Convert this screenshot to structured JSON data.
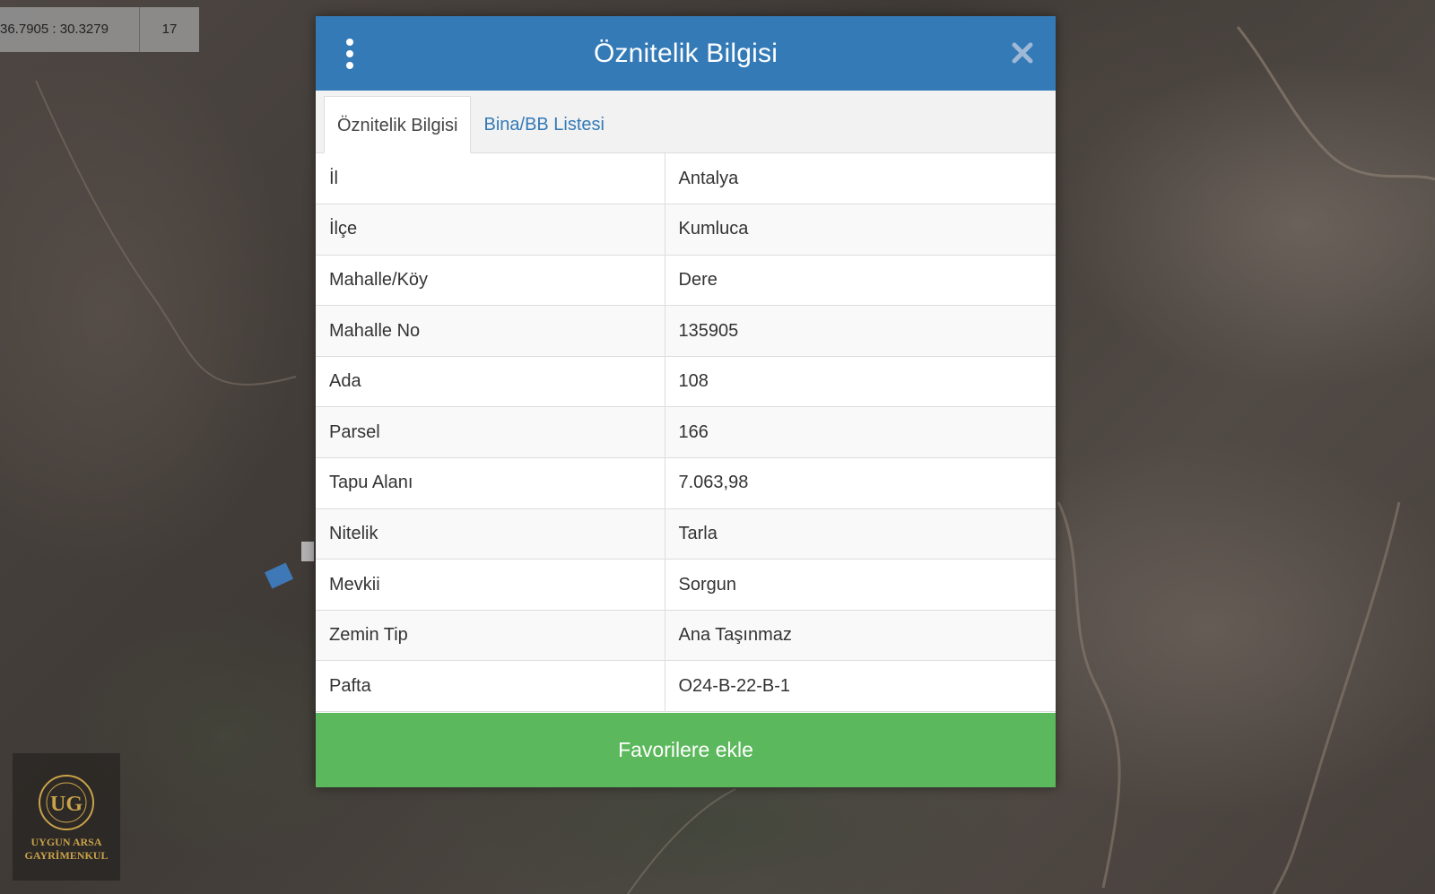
{
  "map": {
    "coordinates": "36.7905 : 30.3279",
    "zoom": "17"
  },
  "logo": {
    "brand_line1": "UYGUN ARSA",
    "brand_line2": "GAYRİMENKUL"
  },
  "modal": {
    "title": "Öznitelik Bilgisi",
    "tabs": [
      {
        "label": "Öznitelik Bilgisi",
        "active": true
      },
      {
        "label": "Bina/BB Listesi",
        "active": false
      }
    ],
    "rows": [
      {
        "key": "İl",
        "value": "Antalya"
      },
      {
        "key": "İlçe",
        "value": "Kumluca"
      },
      {
        "key": "Mahalle/Köy",
        "value": "Dere"
      },
      {
        "key": "Mahalle No",
        "value": "135905"
      },
      {
        "key": "Ada",
        "value": "108"
      },
      {
        "key": "Parsel",
        "value": "166"
      },
      {
        "key": "Tapu Alanı",
        "value": "7.063,98"
      },
      {
        "key": "Nitelik",
        "value": "Tarla"
      },
      {
        "key": "Mevkii",
        "value": "Sorgun"
      },
      {
        "key": "Zemin Tip",
        "value": "Ana Taşınmaz"
      },
      {
        "key": "Pafta",
        "value": "O24-B-22-B-1"
      }
    ],
    "favorite_button_label": "Favorilere ekle"
  },
  "colors": {
    "header": "#337ab7",
    "button": "#5cb85c",
    "tab_link": "#337ab7",
    "logo_gold": "#c9a24a"
  },
  "icons": {
    "menu": "vertical-dots-icon",
    "close": "close-icon"
  }
}
